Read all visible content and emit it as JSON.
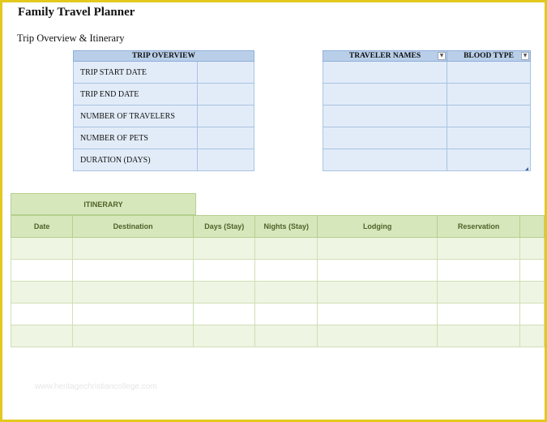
{
  "title": "Family Travel Planner",
  "subtitle": "Trip Overview & Itinerary",
  "overview": {
    "header": "TRIP OVERVIEW",
    "rows": [
      {
        "label": "TRIP START DATE",
        "value": ""
      },
      {
        "label": "TRIP END DATE",
        "value": ""
      },
      {
        "label": "NUMBER OF TRAVELERS",
        "value": ""
      },
      {
        "label": "NUMBER OF PETS",
        "value": ""
      },
      {
        "label": "DURATION (DAYS)",
        "value": ""
      }
    ]
  },
  "travelers": {
    "headers": [
      "TRAVELER NAMES",
      "BLOOD TYPE"
    ],
    "dropdown_icon": "▼",
    "rows": [
      [
        "",
        ""
      ],
      [
        "",
        ""
      ],
      [
        "",
        ""
      ],
      [
        "",
        ""
      ],
      [
        "",
        ""
      ]
    ]
  },
  "itinerary": {
    "banner": "ITINERARY",
    "headers": [
      "Date",
      "Destination",
      "Days (Stay)",
      "Nights (Stay)",
      "Lodging",
      "Reservation",
      ""
    ],
    "rows": [
      [
        "",
        "",
        "",
        "",
        "",
        "",
        ""
      ],
      [
        "",
        "",
        "",
        "",
        "",
        "",
        ""
      ],
      [
        "",
        "",
        "",
        "",
        "",
        "",
        ""
      ],
      [
        "",
        "",
        "",
        "",
        "",
        "",
        ""
      ],
      [
        "",
        "",
        "",
        "",
        "",
        "",
        ""
      ]
    ]
  },
  "watermark": "www.heritagechristiancollege.com",
  "colors": {
    "frame": "#e3c81d",
    "blue_header": "#b9cfe9",
    "blue_cell": "#e2ecf8",
    "green_header": "#d7e7bc",
    "green_band": "#eef5e3",
    "green_text": "#4f6228"
  }
}
